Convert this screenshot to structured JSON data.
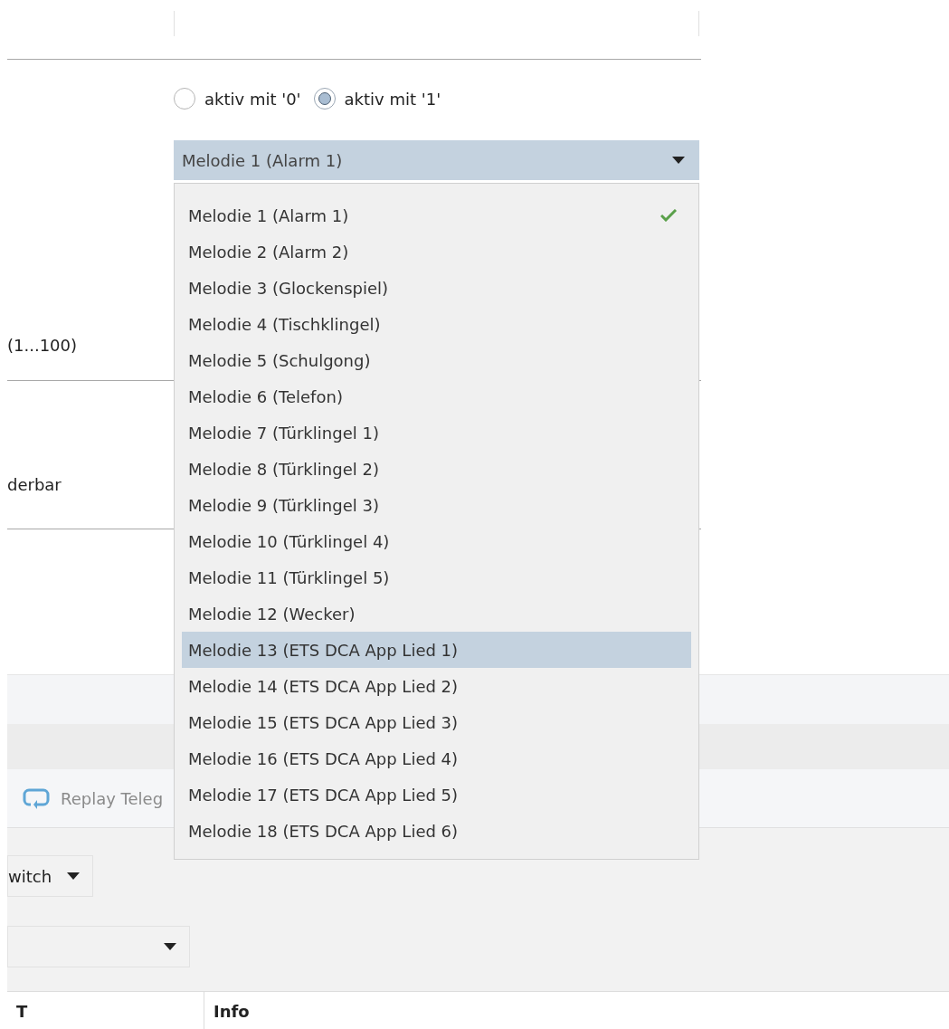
{
  "polarity_options": [
    {
      "label": "aktiv mit '0'",
      "selected": false
    },
    {
      "label": "aktiv mit '1'",
      "selected": true
    }
  ],
  "melody_select": {
    "value": "Melodie 1 (Alarm 1)",
    "options": [
      {
        "label": "Melodie 1 (Alarm 1)",
        "selected": true,
        "highlighted": false
      },
      {
        "label": "Melodie 2 (Alarm 2)",
        "selected": false,
        "highlighted": false
      },
      {
        "label": "Melodie 3 (Glockenspiel)",
        "selected": false,
        "highlighted": false
      },
      {
        "label": "Melodie 4 (Tischklingel)",
        "selected": false,
        "highlighted": false
      },
      {
        "label": "Melodie 5 (Schulgong)",
        "selected": false,
        "highlighted": false
      },
      {
        "label": "Melodie 6 (Telefon)",
        "selected": false,
        "highlighted": false
      },
      {
        "label": "Melodie 7 (Türklingel 1)",
        "selected": false,
        "highlighted": false
      },
      {
        "label": "Melodie 8 (Türklingel 2)",
        "selected": false,
        "highlighted": false
      },
      {
        "label": "Melodie 9 (Türklingel 3)",
        "selected": false,
        "highlighted": false
      },
      {
        "label": "Melodie 10 (Türklingel 4)",
        "selected": false,
        "highlighted": false
      },
      {
        "label": "Melodie 11 (Türklingel 5)",
        "selected": false,
        "highlighted": false
      },
      {
        "label": "Melodie 12 (Wecker)",
        "selected": false,
        "highlighted": false
      },
      {
        "label": "Melodie 13 (ETS DCA App Lied 1)",
        "selected": false,
        "highlighted": true
      },
      {
        "label": "Melodie 14 (ETS DCA App Lied 2)",
        "selected": false,
        "highlighted": false
      },
      {
        "label": "Melodie 15 (ETS DCA App Lied 3)",
        "selected": false,
        "highlighted": false
      },
      {
        "label": "Melodie 16 (ETS DCA App Lied 4)",
        "selected": false,
        "highlighted": false
      },
      {
        "label": "Melodie 17 (ETS DCA App Lied 5)",
        "selected": false,
        "highlighted": false
      },
      {
        "label": "Melodie 18 (ETS DCA App Lied 6)",
        "selected": false,
        "highlighted": false
      }
    ]
  },
  "parameter_labels": [
    "(1...100)",
    "derbar"
  ],
  "toolbar": {
    "replay_button": "Replay Teleg"
  },
  "type_filter": {
    "value": "witch"
  },
  "table": {
    "columns": [
      "T",
      "Info"
    ]
  }
}
